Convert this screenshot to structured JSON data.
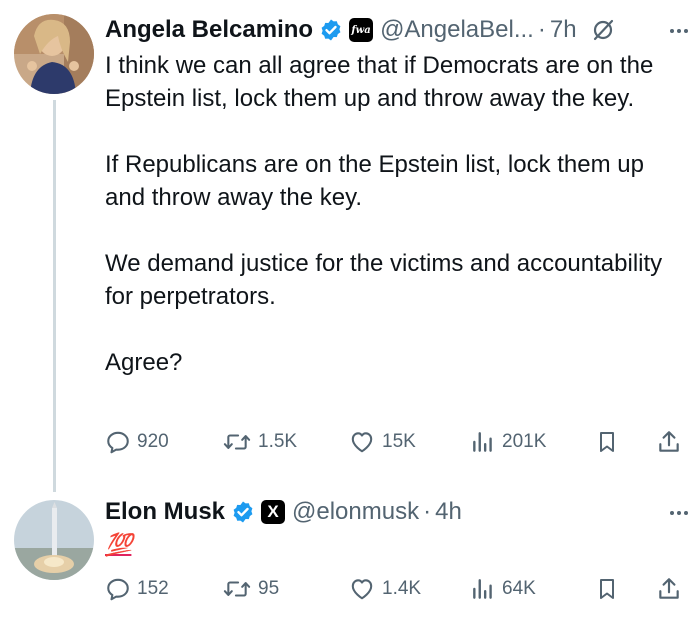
{
  "tweets": [
    {
      "author": {
        "name": "Angela Belcamino",
        "handle": "@AngelaBel...",
        "affiliation_badge": "fwa"
      },
      "time": "7h",
      "body": [
        "I think we can all agree that if Democrats are on the Epstein list, lock them up and throw away the key.",
        "If Republicans are on the Epstein list, lock them up and throw away the key.",
        "We demand justice for the victims and accountability for perpetrators.",
        "Agree?"
      ],
      "stats": {
        "replies": "920",
        "reposts": "1.5K",
        "likes": "15K",
        "views": "201K"
      }
    },
    {
      "author": {
        "name": "Elon Musk",
        "handle": "@elonmusk",
        "affiliation_badge": "X"
      },
      "time": "4h",
      "body": [
        "💯"
      ],
      "stats": {
        "replies": "152",
        "reposts": "95",
        "likes": "1.4K",
        "views": "64K"
      }
    }
  ],
  "separator": "·",
  "icons": {
    "verified": "verified-badge-icon",
    "grok": "grok-icon",
    "more": "more-icon",
    "reply": "reply-icon",
    "repost": "repost-icon",
    "like": "like-icon",
    "views": "views-icon",
    "bookmark": "bookmark-icon",
    "share": "share-icon"
  },
  "colors": {
    "verified": "#1d9bf0",
    "text": "#0f1419",
    "secondary": "#536471",
    "thread_line": "#cfd9de"
  }
}
